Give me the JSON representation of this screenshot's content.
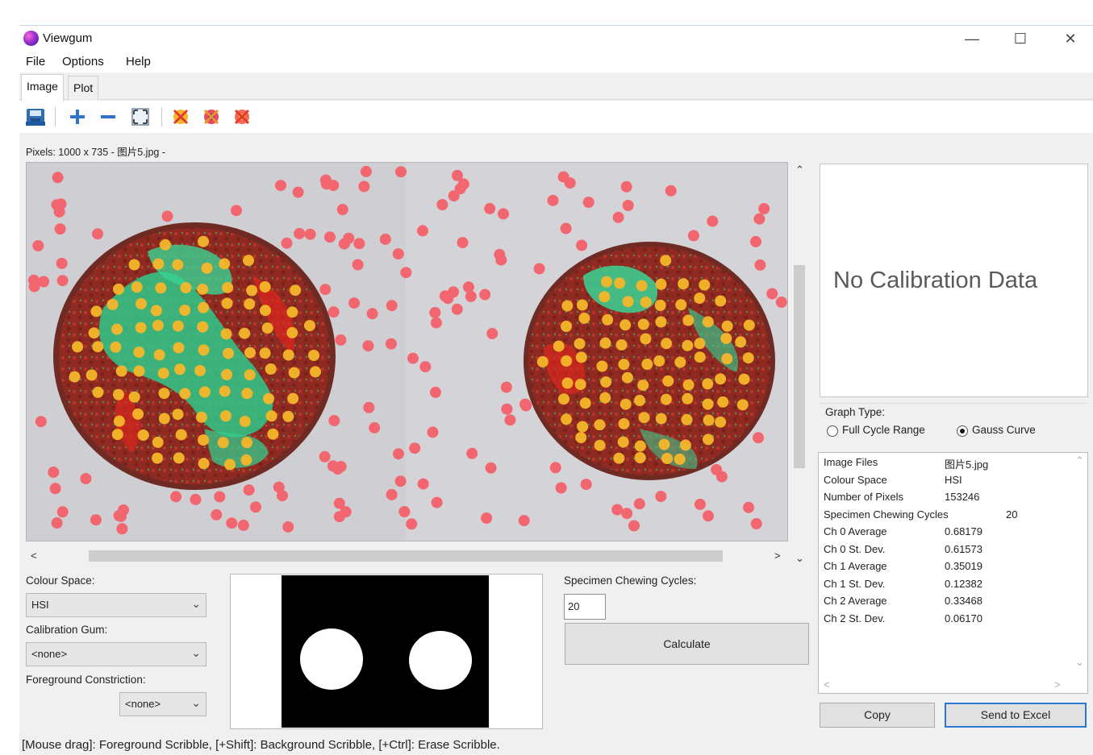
{
  "window": {
    "title": "Viewgum",
    "minimize_glyph": "—",
    "maximize_glyph": "☐",
    "close_glyph": "✕"
  },
  "menu": [
    "File",
    "Options",
    "Help"
  ],
  "tabs": [
    {
      "label": "Image",
      "active": true
    },
    {
      "label": "Plot",
      "active": false
    }
  ],
  "toolbar": {
    "icons": [
      "save-icon",
      "zoom-in-icon",
      "zoom-out-icon",
      "fit-to-window-icon",
      "clear-foreground-scribble-icon",
      "clear-background-scribble-icon",
      "clear-all-scribble-icon"
    ],
    "zoom_in_glyph": "+",
    "zoom_out_glyph": "—"
  },
  "image_info": "Pixels: 1000 x 735 - 图片5.jpg -",
  "left_controls": {
    "colour_space_label": "Colour Space:",
    "colour_space_value": "HSI",
    "calibration_gum_label": "Calibration Gum:",
    "calibration_gum_value": "<none>",
    "foreground_constriction_label": "Foreground Constriction:",
    "foreground_constriction_value": "<none>"
  },
  "specimen": {
    "label": "Specimen Chewing Cycles:",
    "value": "20",
    "calculate_label": "Calculate"
  },
  "calibration": {
    "message": "No Calibration Data"
  },
  "graph_type": {
    "label": "Graph Type:",
    "options": [
      {
        "label": "Full Cycle Range",
        "selected": false
      },
      {
        "label": "Gauss Curve",
        "selected": true
      }
    ]
  },
  "stats": [
    {
      "key": "Image Files",
      "value": "图片5.jpg"
    },
    {
      "key": "Colour Space",
      "value": "HSI"
    },
    {
      "key": "Number of Pixels",
      "value": "153246"
    },
    {
      "key": "Specimen Chewing Cycles",
      "value": "20"
    },
    {
      "key": "Ch 0 Average",
      "value": "0.68179"
    },
    {
      "key": "Ch 0 St. Dev.",
      "value": "0.61573"
    },
    {
      "key": "Ch 1 Average",
      "value": "0.35019"
    },
    {
      "key": "Ch 1 St. Dev.",
      "value": "0.12382"
    },
    {
      "key": "Ch 2 Average",
      "value": "0.33468"
    },
    {
      "key": "Ch 2 St. Dev.",
      "value": "0.06170"
    }
  ],
  "buttons": {
    "copy": "Copy",
    "send_to_excel": "Send to Excel"
  },
  "status_bar": "[Mouse drag]: Foreground Scribble, [+Shift]: Background Scribble, [+Ctrl]: Erase Scribble.",
  "scroll_arrows": {
    "up": "⌃",
    "down": "⌄",
    "left": "<",
    "right": ">"
  },
  "colors": {
    "foreground_marker": "#f5b62a",
    "background_marker": "#f26670",
    "specimen_red": "#9b2b22",
    "specimen_green": "#33d18a",
    "accent": "#2a78d4"
  }
}
